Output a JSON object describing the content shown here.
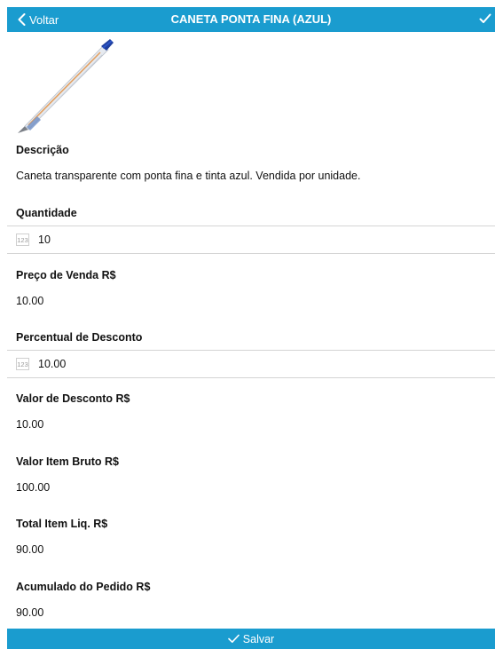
{
  "navbar": {
    "back_label": "Voltar",
    "title": "CANETA PONTA FINA (AZUL)",
    "accent": "#1a9ccf"
  },
  "product": {
    "image": "pen-image",
    "description_label": "Descrição",
    "description": "Caneta transparente com ponta fina e tinta azul. Vendida por unidade."
  },
  "fields": {
    "quantidade_label": "Quantidade",
    "quantidade_value": "10",
    "preco_label": "Preço de Venda R$",
    "preco_value": "10.00",
    "percentual_label": "Percentual de Desconto",
    "percentual_value": "10.00",
    "valor_desconto_label": "Valor de Desconto R$",
    "valor_desconto_value": "10.00",
    "valor_bruto_label": "Valor Item Bruto R$",
    "valor_bruto_value": "100.00",
    "total_liq_label": "Total Item Liq. R$",
    "total_liq_value": "90.00",
    "acumulado_label": "Acumulado do Pedido R$",
    "acumulado_value": "90.00"
  },
  "footer": {
    "save_label": "Salvar"
  },
  "icons": {
    "back": "chevron-left-icon",
    "confirm": "checkmark-icon",
    "numeric": "numeric-keypad-icon"
  }
}
